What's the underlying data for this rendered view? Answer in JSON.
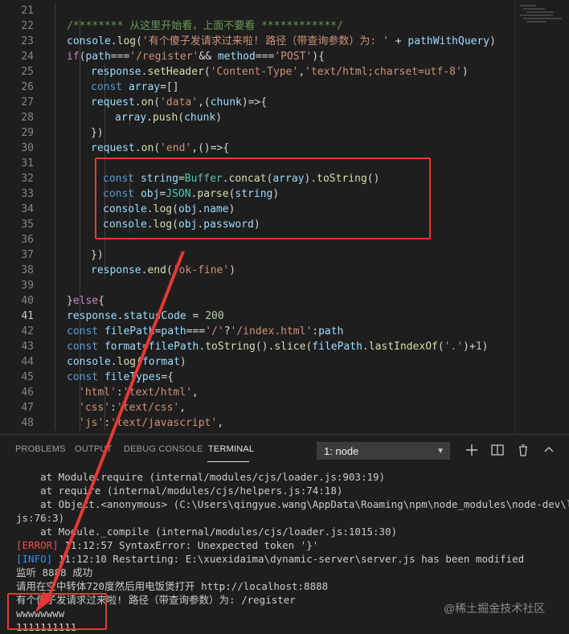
{
  "editor": {
    "active_line": "41",
    "lines": [
      {
        "n": "21",
        "t": []
      },
      {
        "n": "22",
        "t": [
          [
            "cm",
            "/******** 从这里开始看，上面不要看 ************/"
          ]
        ]
      },
      {
        "n": "23",
        "t": [
          [
            "var",
            "console"
          ],
          [
            "pl",
            "."
          ],
          [
            "fn",
            "log"
          ],
          [
            "pl",
            "("
          ],
          [
            "str",
            "'有个傻子发请求过来啦! 路径（带查询参数）为: '"
          ],
          [
            "pl",
            " + "
          ],
          [
            "var",
            "pathWithQuery"
          ],
          [
            "pl",
            ")"
          ]
        ]
      },
      {
        "n": "24",
        "t": [
          [
            "kwc",
            "if"
          ],
          [
            "pl",
            "("
          ],
          [
            "var",
            "path"
          ],
          [
            "pl",
            "==="
          ],
          [
            "str",
            "'/register'"
          ],
          [
            "pl",
            "&& "
          ],
          [
            "var",
            "method"
          ],
          [
            "pl",
            "==="
          ],
          [
            "str",
            "'POST'"
          ],
          [
            "pl",
            "){"
          ]
        ]
      },
      {
        "n": "25",
        "t": [
          [
            "var",
            "response"
          ],
          [
            "pl",
            "."
          ],
          [
            "fn",
            "setHeader"
          ],
          [
            "pl",
            "("
          ],
          [
            "str",
            "'Content-Type'"
          ],
          [
            "pl",
            ","
          ],
          [
            "str",
            "'text/html;charset=utf-8'"
          ],
          [
            "pl",
            ")"
          ]
        ]
      },
      {
        "n": "26",
        "t": [
          [
            "kw",
            "const "
          ],
          [
            "var",
            "array"
          ],
          [
            "pl",
            "=[]"
          ]
        ]
      },
      {
        "n": "27",
        "t": [
          [
            "var",
            "request"
          ],
          [
            "pl",
            "."
          ],
          [
            "fn",
            "on"
          ],
          [
            "pl",
            "("
          ],
          [
            "str",
            "'data'"
          ],
          [
            "pl",
            ",("
          ],
          [
            "var",
            "chunk"
          ],
          [
            "pl",
            ")=>{"
          ]
        ]
      },
      {
        "n": "28",
        "t": [
          [
            "var",
            "array"
          ],
          [
            "pl",
            "."
          ],
          [
            "fn",
            "push"
          ],
          [
            "pl",
            "("
          ],
          [
            "var",
            "chunk"
          ],
          [
            "pl",
            ")"
          ]
        ]
      },
      {
        "n": "29",
        "t": [
          [
            "pl",
            "})"
          ]
        ]
      },
      {
        "n": "30",
        "t": [
          [
            "var",
            "request"
          ],
          [
            "pl",
            "."
          ],
          [
            "fn",
            "on"
          ],
          [
            "pl",
            "("
          ],
          [
            "str",
            "'end'"
          ],
          [
            "pl",
            ",()=>{"
          ]
        ]
      },
      {
        "n": "31",
        "t": []
      },
      {
        "n": "32",
        "t": [
          [
            "kw",
            "const "
          ],
          [
            "var",
            "string"
          ],
          [
            "pl",
            "="
          ],
          [
            "ty",
            "Buffer"
          ],
          [
            "pl",
            "."
          ],
          [
            "fn",
            "concat"
          ],
          [
            "pl",
            "("
          ],
          [
            "var",
            "array"
          ],
          [
            "pl",
            ")."
          ],
          [
            "fn",
            "toString"
          ],
          [
            "pl",
            "()"
          ]
        ]
      },
      {
        "n": "33",
        "t": [
          [
            "kw",
            "const "
          ],
          [
            "var",
            "obj"
          ],
          [
            "pl",
            "="
          ],
          [
            "ty",
            "JSON"
          ],
          [
            "pl",
            "."
          ],
          [
            "fn",
            "parse"
          ],
          [
            "pl",
            "("
          ],
          [
            "var",
            "string"
          ],
          [
            "pl",
            ")"
          ]
        ]
      },
      {
        "n": "34",
        "t": [
          [
            "var",
            "console"
          ],
          [
            "pl",
            "."
          ],
          [
            "fn",
            "log"
          ],
          [
            "pl",
            "("
          ],
          [
            "var",
            "obj"
          ],
          [
            "pl",
            "."
          ],
          [
            "var",
            "name"
          ],
          [
            "pl",
            ")"
          ]
        ]
      },
      {
        "n": "35",
        "t": [
          [
            "var",
            "console"
          ],
          [
            "pl",
            "."
          ],
          [
            "fn",
            "log"
          ],
          [
            "pl",
            "("
          ],
          [
            "var",
            "obj"
          ],
          [
            "pl",
            "."
          ],
          [
            "var",
            "password"
          ],
          [
            "pl",
            ")"
          ]
        ]
      },
      {
        "n": "36",
        "t": []
      },
      {
        "n": "37",
        "t": [
          [
            "pl",
            "})"
          ]
        ]
      },
      {
        "n": "38",
        "t": [
          [
            "var",
            "response"
          ],
          [
            "pl",
            "."
          ],
          [
            "fn",
            "end"
          ],
          [
            "pl",
            "("
          ],
          [
            "str",
            "'ok-fine'"
          ],
          [
            "pl",
            ")"
          ]
        ]
      },
      {
        "n": "39",
        "t": []
      },
      {
        "n": "40",
        "t": [
          [
            "pl",
            "}"
          ],
          [
            "kwc",
            "else"
          ],
          [
            "pl",
            "{"
          ]
        ]
      },
      {
        "n": "41",
        "t": [
          [
            "var",
            "response"
          ],
          [
            "pl",
            "."
          ],
          [
            "var",
            "statusCode"
          ],
          [
            "pl",
            " = "
          ],
          [
            "num",
            "200"
          ]
        ]
      },
      {
        "n": "42",
        "t": [
          [
            "kw",
            "const "
          ],
          [
            "var",
            "filePath"
          ],
          [
            "pl",
            "="
          ],
          [
            "var",
            "path"
          ],
          [
            "pl",
            "==="
          ],
          [
            "str",
            "'/'"
          ],
          [
            "pl",
            "?"
          ],
          [
            "str",
            "'/index.html'"
          ],
          [
            "pl",
            ":"
          ],
          [
            "var",
            "path"
          ]
        ]
      },
      {
        "n": "43",
        "t": [
          [
            "kw",
            "const "
          ],
          [
            "var",
            "format"
          ],
          [
            "pl",
            "="
          ],
          [
            "var",
            "filePath"
          ],
          [
            "pl",
            "."
          ],
          [
            "fn",
            "toString"
          ],
          [
            "pl",
            "()."
          ],
          [
            "fn",
            "slice"
          ],
          [
            "pl",
            "("
          ],
          [
            "var",
            "filePath"
          ],
          [
            "pl",
            "."
          ],
          [
            "fn",
            "lastIndexOf"
          ],
          [
            "pl",
            "("
          ],
          [
            "str",
            "'.'"
          ],
          [
            "pl",
            ")+"
          ],
          [
            "num",
            "1"
          ],
          [
            "pl",
            ")"
          ]
        ]
      },
      {
        "n": "44",
        "t": [
          [
            "var",
            "console"
          ],
          [
            "pl",
            "."
          ],
          [
            "fn",
            "log"
          ],
          [
            "pl",
            "("
          ],
          [
            "var",
            "format"
          ],
          [
            "pl",
            ")"
          ]
        ]
      },
      {
        "n": "45",
        "t": [
          [
            "kw",
            "const "
          ],
          [
            "var",
            "fileTypes"
          ],
          [
            "pl",
            "={"
          ]
        ]
      },
      {
        "n": "46",
        "t": [
          [
            "str",
            "'html'"
          ],
          [
            "pl",
            ":"
          ],
          [
            "str",
            "'text/html'"
          ],
          [
            "pl",
            ","
          ]
        ]
      },
      {
        "n": "47",
        "t": [
          [
            "str",
            "'css'"
          ],
          [
            "pl",
            ":"
          ],
          [
            "str",
            "'text/css'"
          ],
          [
            "pl",
            ","
          ]
        ]
      },
      {
        "n": "48",
        "t": [
          [
            "str",
            "'js'"
          ],
          [
            "pl",
            ":"
          ],
          [
            "str",
            "'text/javascript'"
          ],
          [
            "pl",
            ","
          ]
        ]
      }
    ]
  },
  "panel": {
    "tabs": [
      "PROBLEMS",
      "OUTPUT",
      "DEBUG CONSOLE",
      "TERMINAL"
    ],
    "active_tab": "TERMINAL",
    "terminal_select": "1: node",
    "icons": [
      "plus-icon",
      "split-icon",
      "trash-icon",
      "chevron-up-icon",
      "close-icon"
    ],
    "terminal_lines": [
      {
        "text": "    at Module.require (internal/modules/cjs/loader.js:903:19)"
      },
      {
        "text": "    at require (internal/modules/cjs/helpers.js:74:18)"
      },
      {
        "text": "    at Object.<anonymous> (C:\\Users\\qingyue.wang\\AppData\\Roaming\\npm\\node_modules\\node-dev\\lib\\wrap"
      },
      {
        "text": "js:76:3)"
      },
      {
        "text": "    at Module._compile (internal/modules/cjs/loader.js:1015:30)"
      },
      {
        "tag": "[ERROR]",
        "text": " 11:12:57 SyntaxError: Unexpected token '}'"
      },
      {
        "tag": "[INFO]",
        "text": " 11:12:10 Restarting: E:\\xuexidaima\\dynamic-server\\server.js has been modified"
      },
      {
        "text": "监听 8888 成功"
      },
      {
        "text": "请用在空中转体720度然后用电饭煲打开 http://localhost:8888"
      },
      {
        "text": "有个傻子发请求过来啦! 路径（带查询参数）为: /register"
      },
      {
        "text": "wwwwwwww"
      },
      {
        "text": "1111111111"
      }
    ]
  },
  "watermark": "@稀土掘金技术社区",
  "colors": {
    "annotation": "#e53935",
    "background": "#1e1e1e"
  }
}
